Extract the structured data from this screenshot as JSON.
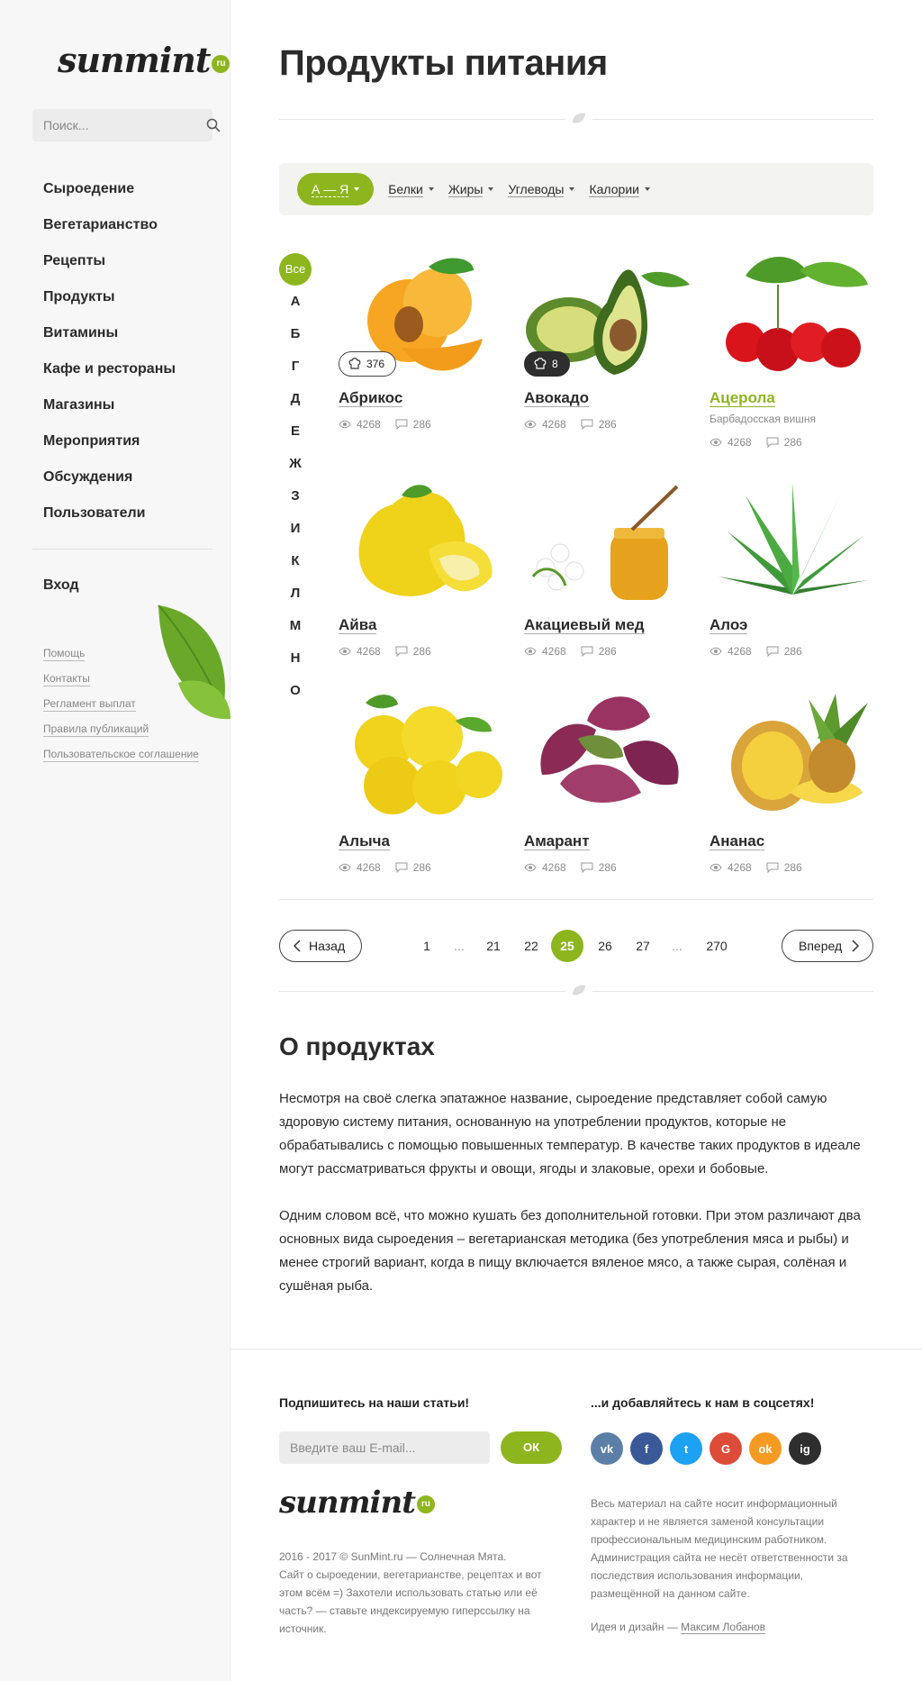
{
  "brand": {
    "name": "sunmint",
    "tld": "ru"
  },
  "search": {
    "placeholder": "Поиск..."
  },
  "nav": {
    "items": [
      "Сыроедение",
      "Вегетарианство",
      "Рецепты",
      "Продукты",
      "Витамины",
      "Кафе и рестораны",
      "Магазины",
      "Мероприятия",
      "Обсуждения",
      "Пользователи"
    ],
    "login": "Вход",
    "secondary": [
      "Помощь",
      "Контакты",
      "Регламент выплат",
      "Правила публикаций",
      "Пользовательское соглашение"
    ]
  },
  "page": {
    "title": "Продукты питания"
  },
  "filters": {
    "active": "А — Я",
    "items": [
      "Белки",
      "Жиры",
      "Углеводы",
      "Калории"
    ]
  },
  "alphabet": [
    "Все",
    "А",
    "Б",
    "Г",
    "Д",
    "Е",
    "Ж",
    "З",
    "И",
    "К",
    "Л",
    "М",
    "Н",
    "О"
  ],
  "products": [
    {
      "name": "Абрикос",
      "views": "4268",
      "comments": "286",
      "badge": "376",
      "badge_style": "light"
    },
    {
      "name": "Авокадо",
      "views": "4268",
      "comments": "286",
      "badge": "8",
      "badge_style": "dark"
    },
    {
      "name": "Ацерола",
      "subtitle": "Барбадосская вишня",
      "views": "4268",
      "comments": "286",
      "highlight": true
    },
    {
      "name": "Айва",
      "views": "4268",
      "comments": "286"
    },
    {
      "name": "Акациевый мед",
      "views": "4268",
      "comments": "286"
    },
    {
      "name": "Алоэ",
      "views": "4268",
      "comments": "286"
    },
    {
      "name": "Алыча",
      "views": "4268",
      "comments": "286"
    },
    {
      "name": "Амарант",
      "views": "4268",
      "comments": "286"
    },
    {
      "name": "Ананас",
      "views": "4268",
      "comments": "286"
    }
  ],
  "pagination": {
    "prev": "Назад",
    "next": "Вперед",
    "pages": [
      "1",
      "...",
      "21",
      "22",
      "25",
      "26",
      "27",
      "...",
      "270"
    ],
    "current": "25"
  },
  "about": {
    "title": "О продуктах",
    "paragraphs": [
      "Несмотря на своё слегка эпатажное название, сыроедение представляет собой самую здоровую систему питания, основанную на употреблении продуктов, которые не обрабатывались с помощью повышенных температур. В качестве таких продуктов в идеале могут рассматриваться фрукты и овощи, ягоды и злаковые, орехи и бобовые.",
      "Одним словом всё, что можно кушать без дополнительной готовки. При этом различают два основных вида сыроедения – вегетарианская методика (без употребления мяса и рыбы) и менее строгий вариант, когда в пищу включается вяленое мясо, а также сырая, солёная и сушёная рыба."
    ]
  },
  "footer": {
    "subscribe_title": "Подпишитесь на наши статьи!",
    "email_placeholder": "Введите ваш E-mail...",
    "ok": "ОК",
    "social_title": "...и добавляйтесь к нам в соцсетях!",
    "socials": [
      {
        "name": "vk-icon",
        "label": "vk",
        "color": "#5b7fa6"
      },
      {
        "name": "facebook-icon",
        "label": "f",
        "color": "#3b5998"
      },
      {
        "name": "twitter-icon",
        "label": "t",
        "color": "#1da1f2"
      },
      {
        "name": "google-icon",
        "label": "G",
        "color": "#dd4b39"
      },
      {
        "name": "odnoklassniki-icon",
        "label": "ok",
        "color": "#f59a23"
      },
      {
        "name": "instagram-icon",
        "label": "ig",
        "color": "#2e2e2e"
      }
    ],
    "copyright": "2016 - 2017 © SunMint.ru — Солнечная Мята.",
    "about": "Сайт о сыроедении, вегетарианстве, рецептах и вот этом всём =) Захотели использовать статью или её часть? — ставьте индексируемую гиперссылку на источник.",
    "disclaimer": "Весь материал на сайте носит информационный характер и не является заменой консультации профессиональным медицинским работником. Администрация сайта не несёт ответственности за последствия использования информации, размещённой на данном сайте.",
    "credit_prefix": "Идея и дизайн —",
    "credit_name": "Максим Лобанов"
  },
  "colors": {
    "accent": "#8db51e",
    "text": "#2b2b2b",
    "muted": "#8a8a8a",
    "sidebar": "#f7f7f7"
  }
}
